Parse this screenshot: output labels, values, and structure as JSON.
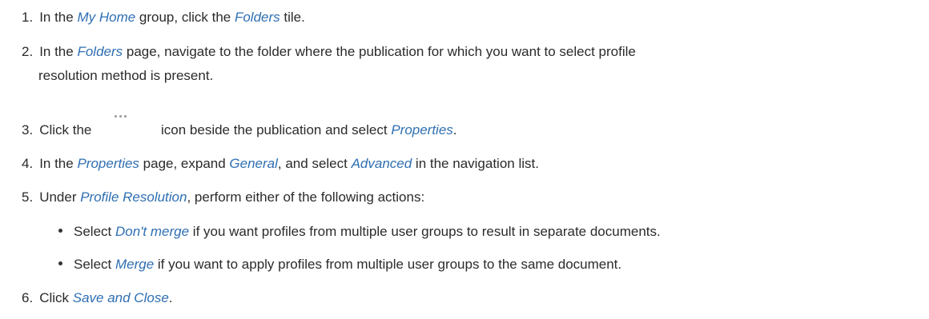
{
  "steps": {
    "s1": {
      "num": "1.",
      "pre": "In the ",
      "link1": "My Home",
      "mid": " group, click the ",
      "link2": "Folders",
      "post": " tile."
    },
    "s2": {
      "num": "2.",
      "pre": "In the ",
      "link1": "Folders",
      "post": " page, navigate to the folder where the publication for which you want to select profile",
      "cont": "resolution method is present."
    },
    "s3": {
      "num": "3.",
      "pre": "Click the",
      "icon": "more-dots-icon",
      "mid": "icon beside the publication and select ",
      "link1": "Properties",
      "post": "."
    },
    "s4": {
      "num": "4.",
      "pre": "In the ",
      "link1": "Properties",
      "mid": " page, expand ",
      "link2": "General",
      "mid2": ", and select ",
      "link3": "Advanced",
      "post": " in the navigation list."
    },
    "s5": {
      "num": "5.",
      "pre": "Under ",
      "link1": "Profile Resolution",
      "post": ", perform either of the following actions:",
      "bullets": [
        {
          "pre": "Select ",
          "link": "Don't merge",
          "post": " if you want profiles from multiple user groups to result in separate documents."
        },
        {
          "pre": "Select ",
          "link": "Merge",
          "post": " if you want to apply profiles from multiple user groups to the same document."
        }
      ]
    },
    "s6": {
      "num": "6.",
      "pre": "Click ",
      "link1": "Save and Close",
      "post": "."
    }
  },
  "colors": {
    "text": "#2b2b2b",
    "link": "#2f6fb2"
  }
}
